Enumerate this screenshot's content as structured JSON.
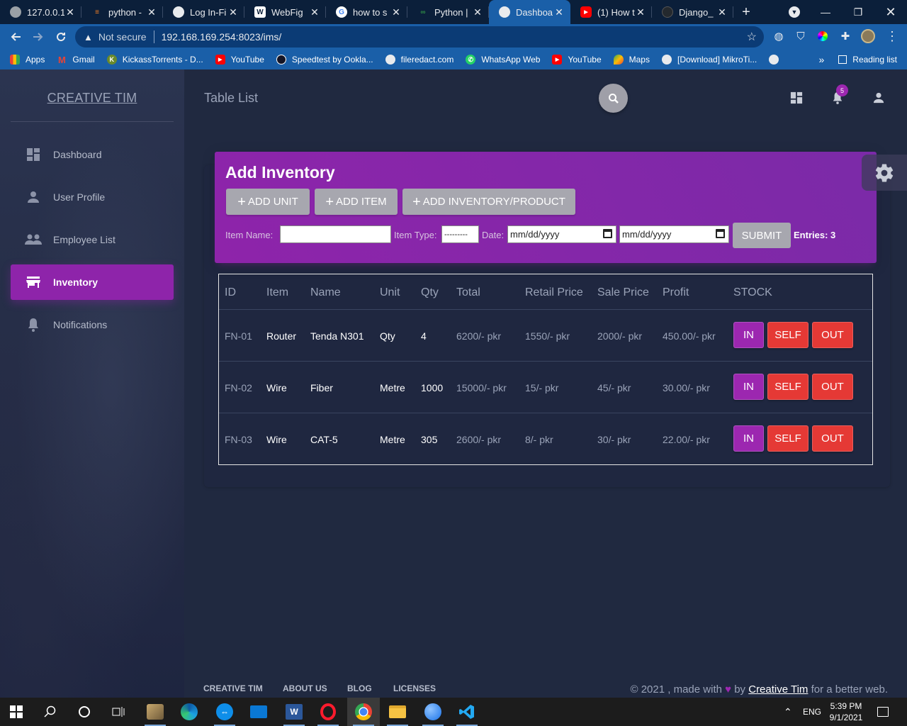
{
  "browser": {
    "tabs": [
      {
        "title": "127.0.0.1",
        "icon": "globe-icon",
        "color": "#5f6368"
      },
      {
        "title": "python -",
        "icon": "stackoverflow-icon",
        "color": "#f48024"
      },
      {
        "title": "Log In-Fi",
        "icon": "globe-icon",
        "color": "#5f6368"
      },
      {
        "title": "WebFig",
        "icon": "webfig-icon",
        "color": "#ffffff"
      },
      {
        "title": "how to s",
        "icon": "google-icon",
        "color": "#4285f4"
      },
      {
        "title": "Python |",
        "icon": "gfg-icon",
        "color": "#2f8d46"
      },
      {
        "title": "Dashboa",
        "icon": "globe-icon",
        "color": "#5f6368"
      },
      {
        "title": "(1) How t",
        "icon": "youtube-icon",
        "color": "#ff0000"
      },
      {
        "title": "Django_",
        "icon": "github-icon",
        "color": "#24292e"
      }
    ],
    "active_tab_index": 6,
    "url_warning": "Not secure",
    "url": "192.168.169.254:8023/ims/",
    "bookmarks": [
      {
        "label": "Apps",
        "icon": "apps-grid-icon",
        "color": "#4285f4"
      },
      {
        "label": "Gmail",
        "icon": "gmail-icon",
        "color": "#ea4335"
      },
      {
        "label": "KickassTorrents - D...",
        "icon": "kickass-icon",
        "color": "#6a8a2b"
      },
      {
        "label": "YouTube",
        "icon": "youtube-icon",
        "color": "#ff0000"
      },
      {
        "label": "Speedtest by Ookla...",
        "icon": "speedtest-icon",
        "color": "#141526"
      },
      {
        "label": "fileredact.com",
        "icon": "globe-icon",
        "color": "#5f6368"
      },
      {
        "label": "WhatsApp Web",
        "icon": "whatsapp-icon",
        "color": "#25d366"
      },
      {
        "label": "YouTube",
        "icon": "youtube-icon",
        "color": "#ff0000"
      },
      {
        "label": "Maps",
        "icon": "maps-icon",
        "color": "#34a853"
      },
      {
        "label": "[Download] MikroTi...",
        "icon": "globe-icon",
        "color": "#5f6368"
      }
    ],
    "more_bookmarks": "»",
    "reading_list": "Reading list"
  },
  "sidebar": {
    "brand": "CREATIVE TIM",
    "items": [
      {
        "label": "Dashboard",
        "icon": "dashboard-icon"
      },
      {
        "label": "User Profile",
        "icon": "person-icon"
      },
      {
        "label": "Employee List",
        "icon": "people-icon"
      },
      {
        "label": "Inventory",
        "icon": "store-icon"
      },
      {
        "label": "Notifications",
        "icon": "bell-icon"
      }
    ],
    "active": "Inventory"
  },
  "topnav": {
    "title": "Table List",
    "notification_count": "5"
  },
  "card": {
    "title": "Add Inventory",
    "buttons": {
      "add_unit": "ADD UNIT",
      "add_item": "ADD ITEM",
      "add_inventory": "ADD INVENTORY/PRODUCT"
    },
    "filters": {
      "item_name_label": "Item Name:",
      "item_name_value": "",
      "item_type_label": "Item Type:",
      "item_type_value": "---------",
      "date_label": "Date:",
      "date_from": "mm/dd/yyyy",
      "date_to": "mm/dd/yyyy",
      "submit": "SUBMIT",
      "entries_label": "Entries:",
      "entries_count": "3"
    }
  },
  "table": {
    "headers": [
      "ID",
      "Item",
      "Name",
      "Unit",
      "Qty",
      "Total",
      "Retail Price",
      "Sale Price",
      "Profit",
      "STOCK"
    ],
    "rows": [
      {
        "id": "FN-01",
        "item": "Router",
        "name": "Tenda N301",
        "unit": "Qty",
        "qty": "4",
        "total": "6200/- pkr",
        "retail": "1550/- pkr",
        "sale": "2000/- pkr",
        "profit": "450.00/- pkr"
      },
      {
        "id": "FN-02",
        "item": "Wire",
        "name": "Fiber",
        "unit": "Metre",
        "qty": "1000",
        "total": "15000/- pkr",
        "retail": "15/- pkr",
        "sale": "45/- pkr",
        "profit": "30.00/- pkr"
      },
      {
        "id": "FN-03",
        "item": "Wire",
        "name": "CAT-5",
        "unit": "Metre",
        "qty": "305",
        "total": "2600/- pkr",
        "retail": "8/- pkr",
        "sale": "30/- pkr",
        "profit": "22.00/- pkr"
      }
    ],
    "stock_buttons": {
      "in": "IN",
      "self": "SELF",
      "out": "OUT"
    }
  },
  "footer": {
    "links": [
      "CREATIVE TIM",
      "ABOUT US",
      "BLOG",
      "LICENSES"
    ],
    "copyright_prefix": "© 2021 , made with",
    "by": "by",
    "author": "Creative Tim",
    "suffix": "for a better web."
  },
  "taskbar": {
    "language": "ENG",
    "time": "5:39 PM",
    "date": "9/1/2021"
  },
  "colors": {
    "accent": "#9c27b0",
    "danger": "#e53935",
    "background": "#202940",
    "browser_blue": "#1a5fa8"
  }
}
